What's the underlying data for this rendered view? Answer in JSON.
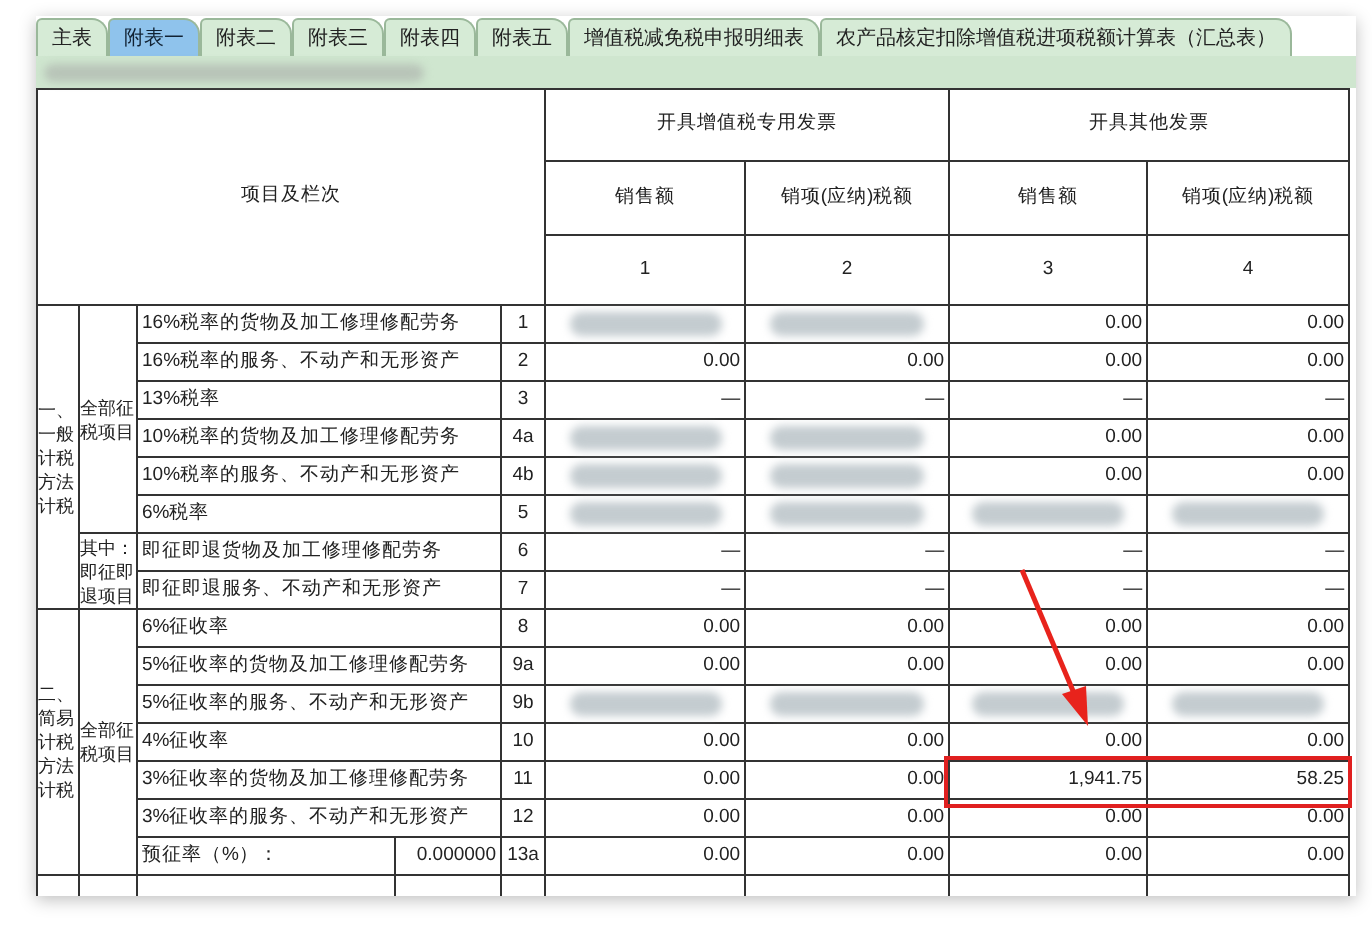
{
  "tabs": [
    {
      "label": "主表",
      "selected": false
    },
    {
      "label": "附表一",
      "selected": true
    },
    {
      "label": "附表二",
      "selected": false
    },
    {
      "label": "附表三",
      "selected": false
    },
    {
      "label": "附表四",
      "selected": false
    },
    {
      "label": "附表五",
      "selected": false
    },
    {
      "label": "增值税减免税申报明细表",
      "selected": false
    },
    {
      "label": "农产品核定扣除增值税进项税额计算表（汇总表）",
      "selected": false
    }
  ],
  "table": {
    "item_header": "项目及栏次",
    "groups": [
      {
        "label": "开具增值税专用发票",
        "columns": [
          {
            "label": "销售额",
            "number": "1"
          },
          {
            "label": "销项(应纳)税额",
            "number": "2"
          }
        ]
      },
      {
        "label": "开具其他发票",
        "columns": [
          {
            "label": "销售额",
            "number": "3"
          },
          {
            "label": "销项(应纳)税额",
            "number": "4"
          }
        ]
      }
    ],
    "sections": [
      {
        "label": "一、一般计税方法计税",
        "groups": [
          {
            "label": "全部征税项目",
            "rows": [
              {
                "item": "16%税率的货物及加工修理修配劳务",
                "line": "1",
                "cells": [
                  {
                    "kind": "blurred"
                  },
                  {
                    "kind": "blurred"
                  },
                  {
                    "kind": "text",
                    "text": "0.00"
                  },
                  {
                    "kind": "text",
                    "text": "0.00"
                  }
                ]
              },
              {
                "item": "16%税率的服务、不动产和无形资产",
                "line": "2",
                "cells": [
                  {
                    "kind": "text",
                    "text": "0.00"
                  },
                  {
                    "kind": "text",
                    "text": "0.00"
                  },
                  {
                    "kind": "text",
                    "text": "0.00"
                  },
                  {
                    "kind": "text",
                    "text": "0.00"
                  }
                ]
              },
              {
                "item": "13%税率",
                "line": "3",
                "cells": [
                  {
                    "kind": "text",
                    "text": "—"
                  },
                  {
                    "kind": "text",
                    "text": "—"
                  },
                  {
                    "kind": "text",
                    "text": "—"
                  },
                  {
                    "kind": "text",
                    "text": "—"
                  }
                ]
              },
              {
                "item": "10%税率的货物及加工修理修配劳务",
                "line": "4a",
                "cells": [
                  {
                    "kind": "blurred"
                  },
                  {
                    "kind": "blurred"
                  },
                  {
                    "kind": "text",
                    "text": "0.00"
                  },
                  {
                    "kind": "text",
                    "text": "0.00"
                  }
                ]
              },
              {
                "item": "10%税率的服务、不动产和无形资产",
                "line": "4b",
                "cells": [
                  {
                    "kind": "blurred"
                  },
                  {
                    "kind": "blurred"
                  },
                  {
                    "kind": "text",
                    "text": "0.00"
                  },
                  {
                    "kind": "text",
                    "text": "0.00"
                  }
                ]
              },
              {
                "item": "6%税率",
                "line": "5",
                "cells": [
                  {
                    "kind": "blurred"
                  },
                  {
                    "kind": "blurred"
                  },
                  {
                    "kind": "blurred"
                  },
                  {
                    "kind": "blurred"
                  }
                ]
              }
            ]
          },
          {
            "label": "其中：即征即退项目",
            "rows": [
              {
                "item": "即征即退货物及加工修理修配劳务",
                "line": "6",
                "cells": [
                  {
                    "kind": "text",
                    "text": "—"
                  },
                  {
                    "kind": "text",
                    "text": "—"
                  },
                  {
                    "kind": "text",
                    "text": "—"
                  },
                  {
                    "kind": "text",
                    "text": "—"
                  }
                ]
              },
              {
                "item": "即征即退服务、不动产和无形资产",
                "line": "7",
                "cells": [
                  {
                    "kind": "text",
                    "text": "—"
                  },
                  {
                    "kind": "text",
                    "text": "—"
                  },
                  {
                    "kind": "text",
                    "text": "—"
                  },
                  {
                    "kind": "text",
                    "text": "—"
                  }
                ]
              }
            ]
          }
        ]
      },
      {
        "label": "二、简易计税方法计税",
        "groups": [
          {
            "label": "全部征税项目",
            "rows": [
              {
                "item": "6%征收率",
                "line": "8",
                "cells": [
                  {
                    "kind": "text",
                    "text": "0.00"
                  },
                  {
                    "kind": "text",
                    "text": "0.00"
                  },
                  {
                    "kind": "text",
                    "text": "0.00"
                  },
                  {
                    "kind": "text",
                    "text": "0.00"
                  }
                ]
              },
              {
                "item": "5%征收率的货物及加工修理修配劳务",
                "line": "9a",
                "cells": [
                  {
                    "kind": "text",
                    "text": "0.00"
                  },
                  {
                    "kind": "text",
                    "text": "0.00"
                  },
                  {
                    "kind": "text",
                    "text": "0.00"
                  },
                  {
                    "kind": "text",
                    "text": "0.00"
                  }
                ]
              },
              {
                "item": "5%征收率的服务、不动产和无形资产",
                "line": "9b",
                "cells": [
                  {
                    "kind": "blurred"
                  },
                  {
                    "kind": "blurred"
                  },
                  {
                    "kind": "blurred"
                  },
                  {
                    "kind": "blurred"
                  }
                ]
              },
              {
                "item": "4%征收率",
                "line": "10",
                "cells": [
                  {
                    "kind": "text",
                    "text": "0.00"
                  },
                  {
                    "kind": "text",
                    "text": "0.00"
                  },
                  {
                    "kind": "text",
                    "text": "0.00"
                  },
                  {
                    "kind": "text",
                    "text": "0.00"
                  }
                ]
              },
              {
                "item": "3%征收率的货物及加工修理修配劳务",
                "line": "11",
                "highlighted": true,
                "cells": [
                  {
                    "kind": "text",
                    "text": "0.00"
                  },
                  {
                    "kind": "text",
                    "text": "0.00"
                  },
                  {
                    "kind": "text",
                    "text": "1,941.75"
                  },
                  {
                    "kind": "text",
                    "text": "58.25"
                  }
                ]
              },
              {
                "item": "3%征收率的服务、不动产和无形资产",
                "line": "12",
                "cells": [
                  {
                    "kind": "text",
                    "text": "0.00"
                  },
                  {
                    "kind": "text",
                    "text": "0.00"
                  },
                  {
                    "kind": "text",
                    "text": "0.00"
                  },
                  {
                    "kind": "text",
                    "text": "0.00"
                  }
                ]
              },
              {
                "item": "预征率（%）：",
                "rate": "0.000000",
                "line": "13a",
                "cells": [
                  {
                    "kind": "text",
                    "text": "0.00"
                  },
                  {
                    "kind": "text",
                    "text": "0.00"
                  },
                  {
                    "kind": "text",
                    "text": "0.00"
                  },
                  {
                    "kind": "text",
                    "text": "0.00"
                  }
                ]
              }
            ]
          }
        ]
      }
    ]
  }
}
